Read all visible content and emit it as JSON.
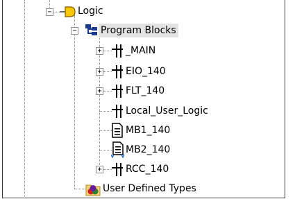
{
  "tree": {
    "logic": {
      "label": "Logic",
      "expander": "−"
    },
    "program_blocks": {
      "label": "Program Blocks",
      "expander": "−"
    },
    "items": [
      {
        "label": "_MAIN",
        "expander": "+"
      },
      {
        "label": "EIO_140",
        "expander": "+"
      },
      {
        "label": "FLT_140",
        "expander": "+"
      },
      {
        "label": "Local_User_Logic",
        "expander": ""
      },
      {
        "label": "MB1_140",
        "expander": ""
      },
      {
        "label": "MB2_140",
        "expander": ""
      },
      {
        "label": "RCC_140",
        "expander": "+"
      }
    ],
    "user_defined_types": {
      "label": "User Defined Types"
    }
  },
  "colors": {
    "logic_icon": "#f7c600",
    "program_blocks_icon": "#1a3b8e",
    "selection_bg": "#e3e3e3"
  }
}
